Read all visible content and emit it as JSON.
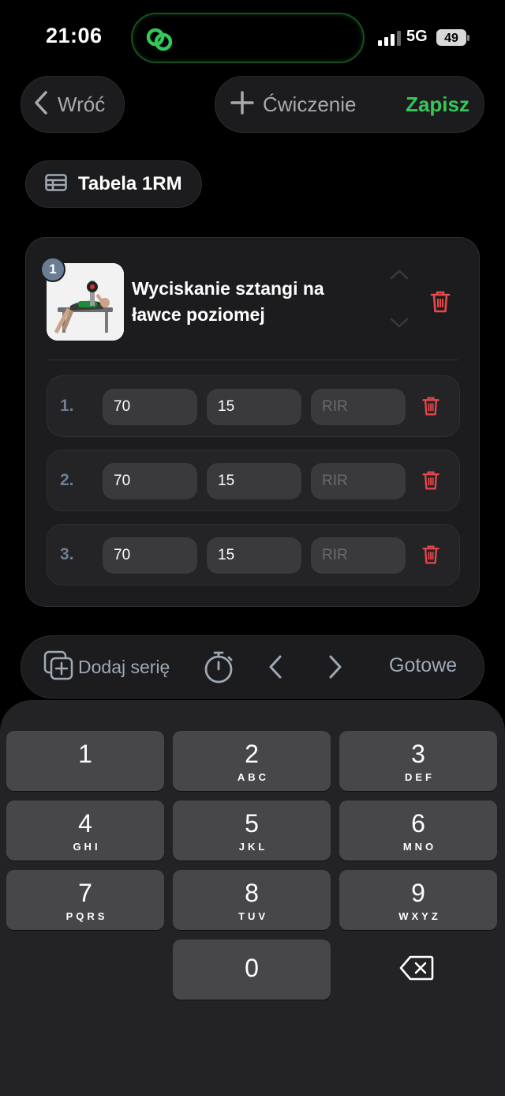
{
  "status": {
    "time": "21:06",
    "network": "5G",
    "battery": "49"
  },
  "header": {
    "back_label": "Wróć",
    "add_exercise_label": "Ćwiczenie",
    "save_label": "Zapisz"
  },
  "table_button": {
    "label": "Tabela 1RM"
  },
  "exercise": {
    "index": "1",
    "title": "Wyciskanie sztangi na ławce poziomej",
    "sets": [
      {
        "num": "1.",
        "weight": "70",
        "reps": "15",
        "rir_placeholder": "RIR"
      },
      {
        "num": "2.",
        "weight": "70",
        "reps": "15",
        "rir_placeholder": "RIR"
      },
      {
        "num": "3.",
        "weight": "70",
        "reps": "15",
        "rir_placeholder": "RIR"
      }
    ]
  },
  "accessory": {
    "add_set_label": "Dodaj serię",
    "done_label": "Gotowe"
  },
  "keypad": {
    "keys": [
      {
        "digit": "1",
        "letters": ""
      },
      {
        "digit": "2",
        "letters": "ABC"
      },
      {
        "digit": "3",
        "letters": "DEF"
      },
      {
        "digit": "4",
        "letters": "GHI"
      },
      {
        "digit": "5",
        "letters": "JKL"
      },
      {
        "digit": "6",
        "letters": "MNO"
      },
      {
        "digit": "7",
        "letters": "PQRS"
      },
      {
        "digit": "8",
        "letters": "TUV"
      },
      {
        "digit": "9",
        "letters": "WXYZ"
      },
      {
        "digit": "0",
        "letters": ""
      }
    ]
  },
  "colors": {
    "accent_green": "#35c759",
    "danger_red": "#e5484d",
    "muted_blue_gray": "#6f7e90"
  }
}
